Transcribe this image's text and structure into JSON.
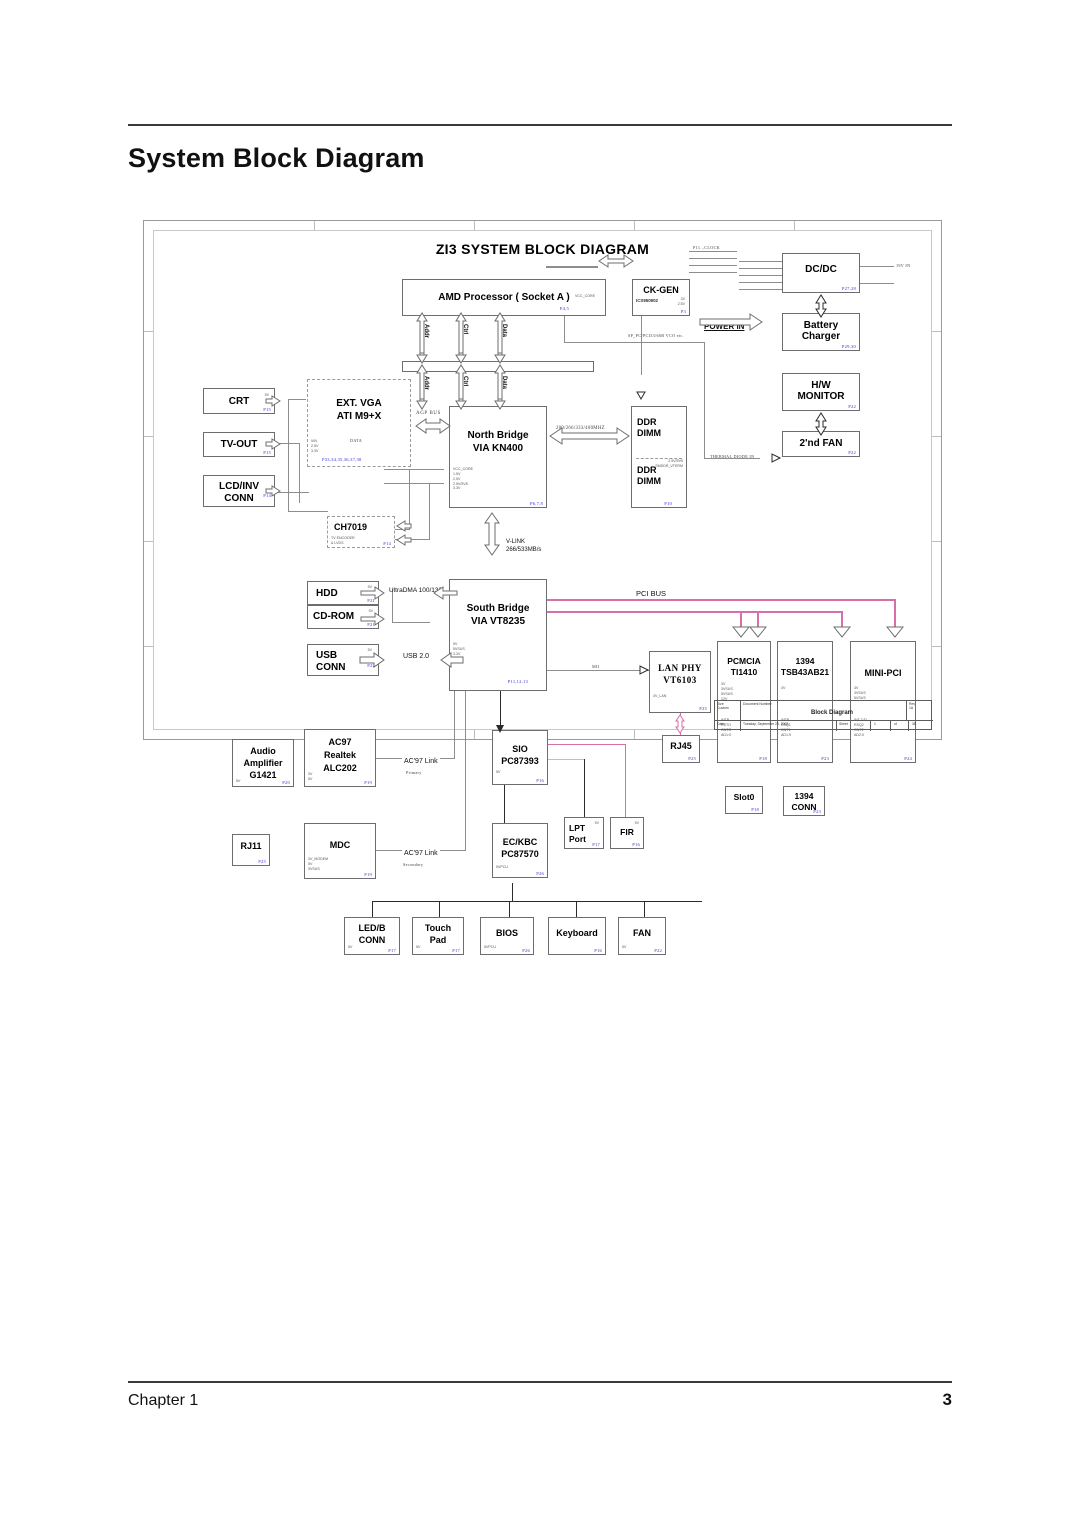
{
  "page": {
    "title": "System Block Diagram",
    "footer_left": "Chapter 1",
    "footer_page": "3"
  },
  "diagram": {
    "title": "ZI3 SYSTEM BLOCK DIAGRAM",
    "bus_labels": {
      "addr": "Addr",
      "ctrl": "Ctrl",
      "data": "Data",
      "agp": "AGP BUS",
      "mem_speed": "200/266/333/400MHZ",
      "vlink": "V-LINK",
      "vlink_speed": "266/533MB/s",
      "pci": "PCI BUS",
      "mii": "MII",
      "ide": "UltraDMA 100/133",
      "usb": "USB 2.0",
      "ac97_primary_link": "AC'97 Link",
      "ac97_primary_sub": "Primary",
      "ac97_secondary_link": "AC'97 Link",
      "ac97_secondary_sub": "Secondary",
      "power_in": "POWER IN",
      "thermal": "THERMAL DIODE IN",
      "ckgen_out": "P11..,CLOCK",
      "ckgen_note": "SP_PC/PCI33/66B VCO etc.",
      "dcdc_out": "19V IN"
    },
    "blocks": [
      {
        "id": "cpu",
        "name": "AMD Processor ( Socket A )",
        "sub": "",
        "pins": "VCC_CORE",
        "ref": "P4,5"
      },
      {
        "id": "ckgen",
        "name": "CK-GEN",
        "sub": "ICS950902",
        "pins": "3V\n2.5V",
        "ref": "P3"
      },
      {
        "id": "dcdc",
        "name": "DC/DC",
        "sub": "",
        "pins": "",
        "ref": "P27,28"
      },
      {
        "id": "battery",
        "name": "Battery\nCharger",
        "sub": "",
        "pins": "",
        "ref": "P29,30"
      },
      {
        "id": "hwmon",
        "name": "H/W\nMONITOR",
        "sub": "",
        "pins": "",
        "ref": "P22"
      },
      {
        "id": "fan2",
        "name": "2'nd FAN",
        "sub": "",
        "pins": "",
        "ref": "P22"
      },
      {
        "id": "extvga",
        "name": "EXT. VGA\nATI M9+X",
        "sub": "",
        "pins": "VIN\n2.5V\n3.3V",
        "ref": "P33,34,35,36,37,38"
      },
      {
        "id": "northbridge",
        "name": "North Bridge\nVIA KN400",
        "sub": "",
        "pins": "VCC_CORE\n1.5V\n2.5V\n2.5V/5V5\n3.3V",
        "ref": "P6,7,8"
      },
      {
        "id": "ddr1",
        "name": "DDR\nDIMM",
        "sub": "",
        "pins": "",
        "ref": ""
      },
      {
        "id": "ddr2",
        "name": "DDR\nDIMM",
        "sub": "",
        "pins": "2.5V/5V5\nSMDDR_VTERM",
        "ref": "P10"
      },
      {
        "id": "crt",
        "name": "CRT",
        "sub": "",
        "pins": "5V",
        "ref": "P15"
      },
      {
        "id": "tvout",
        "name": "TV-OUT",
        "sub": "",
        "pins": "",
        "ref": "P15"
      },
      {
        "id": "lcdinv",
        "name": "LCD/INV\nCONN",
        "sub": "",
        "pins": "",
        "ref": "P14"
      },
      {
        "id": "ch7019",
        "name": "CH7019",
        "sub": "TV ENCODER\n& LVDS",
        "pins": "",
        "ref": "P14"
      },
      {
        "id": "hdd",
        "name": "HDD",
        "sub": "",
        "pins": "5V",
        "ref": "P21"
      },
      {
        "id": "cdrom",
        "name": "CD-ROM",
        "sub": "",
        "pins": "5V",
        "ref": "P21"
      },
      {
        "id": "usbconn",
        "name": "USB\nCONN",
        "sub": "",
        "pins": "5V",
        "ref": "P22"
      },
      {
        "id": "southbridge",
        "name": "South Bridge\nVIA VT8235",
        "sub": "",
        "pins": "5V\n5VSUS\n3.3V\nRVCC",
        "ref": "P11,12,13"
      },
      {
        "id": "ac97",
        "name": "AC97\nRealtek\nALC202",
        "sub": "",
        "pins": "3V\n5V",
        "ref": "P19"
      },
      {
        "id": "audioamp",
        "name": "Audio\nAmplifier\nG1421",
        "sub": "",
        "pins": "5V",
        "ref": "P20"
      },
      {
        "id": "mdc",
        "name": "MDC",
        "sub": "",
        "pins": "3V_MODEM\n5V\n3VSUS",
        "ref": "P19"
      },
      {
        "id": "rj11",
        "name": "RJ11",
        "sub": "",
        "pins": "",
        "ref": "P25"
      },
      {
        "id": "sio",
        "name": "SIO\nPC87393",
        "sub": "",
        "pins": "5V",
        "ref": "P16"
      },
      {
        "id": "eckbc",
        "name": "EC/KBC\nPC87570",
        "sub": "",
        "pins": "5VPCU",
        "ref": "P26"
      },
      {
        "id": "lpt",
        "name": "LPT\nPort",
        "sub": "",
        "pins": "5V",
        "ref": "P17"
      },
      {
        "id": "fir",
        "name": "FIR",
        "sub": "",
        "pins": "5V",
        "ref": "P16"
      },
      {
        "id": "lanphy",
        "name": "LAN PHY\nVT6103",
        "sub": "",
        "pins": "3V_LAN",
        "ref": "P25"
      },
      {
        "id": "rj45",
        "name": "RJ45",
        "sub": "",
        "pins": "",
        "ref": "P25"
      },
      {
        "id": "pcmcia",
        "name": "PCMCIA\nTI1410",
        "sub": "",
        "pins": "3V\n3VSUS\n5VSUS\n12V",
        "pins2": "INTB\nRSTO\nGNTO\nAD1:0",
        "ref": "P18"
      },
      {
        "id": "slot0",
        "name": "Slot0",
        "sub": "",
        "pins": "",
        "ref": "P18"
      },
      {
        "id": "fw1394",
        "name": "1394\nTSB43AB21",
        "sub": "",
        "pins": "3V",
        "pins2": "INTB\nRSQ1\nGNT1\nAD1:9",
        "ref": "P23"
      },
      {
        "id": "conn1394",
        "name": "1394\nCONN",
        "sub": "",
        "pins": "",
        "ref": "P23"
      },
      {
        "id": "minipci",
        "name": "MINI-PCI",
        "sub": "",
        "pins": "3V\n3VSUS\n5VSUS",
        "pins2": "INT C/D\nRSQ2\nGNT2\nAD2:0",
        "ref": "P24"
      },
      {
        "id": "ledb",
        "name": "LED/B\nCONN",
        "sub": "",
        "pins": "5V",
        "ref": "P17"
      },
      {
        "id": "touchpad",
        "name": "Touch\nPad",
        "sub": "",
        "pins": "5V",
        "ref": "P17"
      },
      {
        "id": "bios",
        "name": "BIOS",
        "sub": "",
        "pins": "5VPCU",
        "ref": "P26"
      },
      {
        "id": "keyboard",
        "name": "Keyboard",
        "sub": "",
        "pins": "",
        "ref": "P16"
      },
      {
        "id": "fan",
        "name": "FAN",
        "sub": "",
        "pins": "5V",
        "ref": "P22"
      }
    ],
    "title_block": {
      "size_label": "Size\nCustom",
      "docnum_label": "Document Number:",
      "doc_title": "Block Diagram",
      "rev_label": "Rev\n1A",
      "date_label": "Date:",
      "date_value": "Tuesday, September 23, 2003",
      "sheet_label": "Sheet",
      "sheet_value": "1",
      "of_label": "of",
      "of_value": "38"
    }
  },
  "colors": {
    "pci_bus": "#d96fa8",
    "page_ref": "#3a33d6",
    "line": "#8d8d8d"
  }
}
